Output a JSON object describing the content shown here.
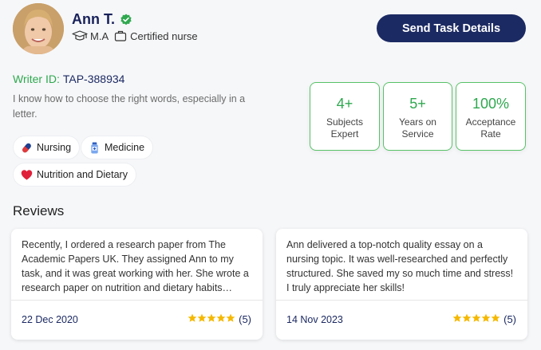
{
  "profile": {
    "name": "Ann T.",
    "degree": "M.A",
    "role": "Certified nurse",
    "writer_id_label": "Writer ID:",
    "writer_id": "TAP-388934",
    "bio": "I know how to choose the right words, especially in a letter."
  },
  "header": {
    "send_button_label": "Send Task Details"
  },
  "tags": [
    {
      "label": "Nursing",
      "icon": "pill-icon"
    },
    {
      "label": "Medicine",
      "icon": "medicine-bottle-icon"
    },
    {
      "label": "Nutrition and Dietary",
      "icon": "heart-icon"
    }
  ],
  "stats": [
    {
      "value": "4+",
      "label": "Subjects Expert"
    },
    {
      "value": "5+",
      "label": "Years on Service"
    },
    {
      "value": "100%",
      "label": "Acceptance Rate"
    }
  ],
  "reviews": {
    "title": "Reviews",
    "items": [
      {
        "text": "Recently, I ordered a research paper from The Academic Papers UK. They assigned Ann to my task, and it was great working with her. She wrote a research paper on nutrition and dietary habits that…",
        "date": "22 Dec 2020",
        "stars": 5,
        "count": "(5)"
      },
      {
        "text": "Ann delivered a top-notch quality essay on a nursing topic. It was well-researched and perfectly structured. She saved my so much time and stress! I truly appreciate her skills!",
        "date": "14 Nov 2023",
        "stars": 5,
        "count": "(5)"
      }
    ]
  },
  "colors": {
    "navy": "#1c2a63",
    "green": "#2fa84f",
    "star": "#f5b800"
  }
}
